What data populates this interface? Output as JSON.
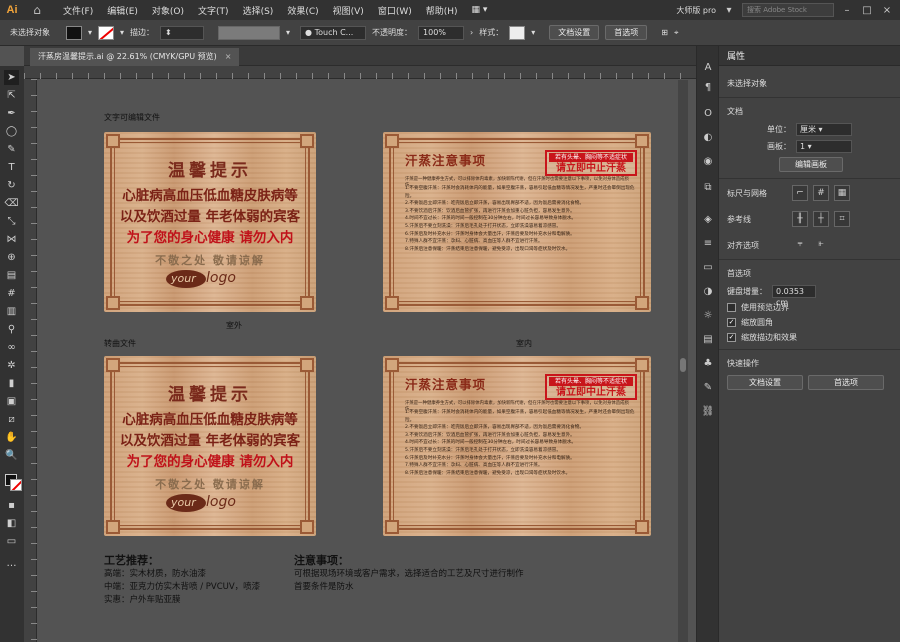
{
  "menubar": {
    "logo": "Ai",
    "items": [
      "文件(F)",
      "编辑(E)",
      "对象(O)",
      "文字(T)",
      "选择(S)",
      "效果(C)",
      "视图(V)",
      "窗口(W)",
      "帮助(H)"
    ],
    "workspace": "大师版 pro",
    "search_placeholder": "搜索 Adobe Stock"
  },
  "control": {
    "no_selection": "未选择对象",
    "stroke_label": "描边：",
    "brush_name": "Touch C...",
    "opacity_label": "不透明度：",
    "opacity_value": "100%",
    "style_label": "样式：",
    "doc_setup": "文档设置",
    "preferences": "首选项"
  },
  "tab": {
    "title": "汗蒸房温馨提示.ai @ 22.61% (CMYK/GPU 预览)",
    "close": "×"
  },
  "artboard": {
    "label_editable": "文字可编辑文件",
    "label_outdoor": "室外",
    "label_curved": "转曲文件",
    "label_indoor": "室内",
    "board_a": {
      "title": "温馨提示",
      "line1": "心脏病高血压低血糖皮肤病等",
      "line2": "以及饮酒过量 年老体弱的宾客",
      "line3": "为了您的身心健康 请勿入内",
      "sub": "不敬之处  敬请谅解",
      "logo1": "your",
      "logo2": "logo"
    },
    "board_b": {
      "title": "汗蒸注意事项",
      "stamp_top": "若有头晕、胸闷等不适症状",
      "stamp_main": "请立即中止汗蒸",
      "intro": "汗蒸是一种健康养生方式，可以排除体内毒素，加快新陈代谢，但在汗蒸时也需要注意以下事项，以免对身体造成损伤。",
      "items": [
        "1.不要空腹汗蒸：汗蒸时会消耗体内的能量，如果空腹汗蒸，容易引起低血糖等情况发生，严重时还会晕倒出现危险。",
        "2.不要饭后立即汗蒸：吃完饭后立即汗蒸，容易出现胃部不适，因为饭后需要消化食物。",
        "3.不要饮酒后汗蒸：饮酒后血管扩张，再进行汗蒸会加重心脏负担，容易发生意外。",
        "4.时间不宜过长：汗蒸的时间一般控制在30分钟左右，时间过长容易导致身体脱水。",
        "5.汗蒸后不要立刻洗澡：汗蒸后毛孔处于打开状态，立即洗澡容易着凉感冒。",
        "6.汗蒸后及时补充水分：汗蒸时身体会大量出汗，汗蒸后要及时补充水分和电解质。",
        "7.特殊人群不宜汗蒸：孕妇、心脏病、高血压等人群不宜进行汗蒸。",
        "8.汗蒸后注意保暖：汗蒸结束后注意保暖，避免受凉，出现口渴等症状及时饮水。"
      ]
    }
  },
  "craft": {
    "title": "工艺推荐：",
    "lines": [
      "高端：实木材质，防水油漆",
      "中端：亚克力仿实木背喷 / PVCUV，喷漆",
      "实惠：户外车贴亚膜"
    ]
  },
  "notes": {
    "title": "注意事项：",
    "lines": [
      "可根据现场环境或客户需求，选择适合的工艺及尺寸进行制作",
      "首要条件是防水"
    ]
  },
  "props": {
    "tab": "属性",
    "no_selection": "未选择对象",
    "doc_section": "文档",
    "unit_label": "单位：",
    "unit_value": "厘米",
    "artboard_label": "画板：",
    "artboard_value": "1",
    "edit_artboards": "编辑画板",
    "rulers_grids": "标尺与网格",
    "guides": "参考线",
    "align_opts": "对齐选项",
    "prefs_section": "首选项",
    "key_increment_label": "键盘增量：",
    "key_increment_value": "0.0353 cm",
    "preview_bounds": "使用预览边界",
    "scale_corners": "缩放圆角",
    "scale_strokes": "缩放描边和效果",
    "quick_actions": "快速操作",
    "doc_setup_btn": "文档设置",
    "prefs_btn": "首选项"
  },
  "colors": {
    "accent": "#f2a43a",
    "board_red": "#c8151b",
    "board_brown": "#7b2216"
  }
}
